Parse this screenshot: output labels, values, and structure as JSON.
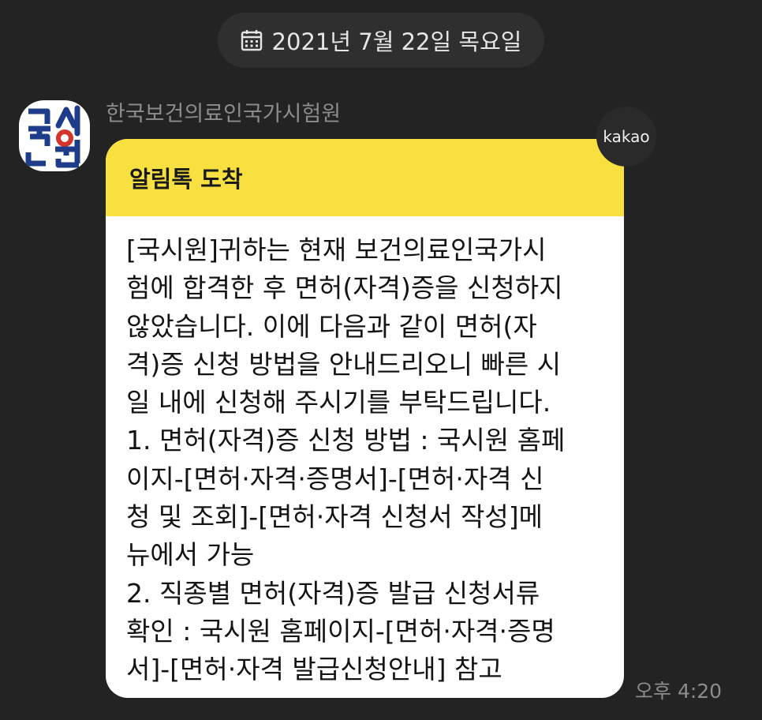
{
  "date_divider": {
    "icon": "calendar-icon",
    "text": "2021년 7월 22일 목요일"
  },
  "sender": {
    "avatar_icon": "kuksiwon-logo",
    "name": "한국보건의료인국가시험원"
  },
  "message": {
    "header_title": "알림톡 도착",
    "badge": "kakao",
    "body_lines": [
      "[국시원]귀하는 현재 보건의료인국가시",
      "험에 합격한 후 면허(자격)증을 신청하지",
      " 않았습니다. 이에 다음과 같이 면허(자",
      "격)증 신청 방법을 안내드리오니 빠른 시",
      "일 내에 신청해 주시기를 부탁드립니다.",
      "1. 면허(자격)증 신청 방법 : 국시원 홈페",
      "이지-[면허·자격·증명서]-[면허·자격 신",
      "청 및 조회]-[면허·자격 신청서 작성]메",
      "뉴에서 가능",
      "2. 직종별 면허(자격)증 발급 신청서류",
      "확인 : 국시원 홈페이지-[면허·자격·증명",
      "서]-[면허·자격 발급신청안내] 참고"
    ],
    "time": "오후 4:20"
  },
  "colors": {
    "background": "#232323",
    "header_yellow": "#f7e03f",
    "logo_blue": "#1f3c8a",
    "logo_red": "#d6332d"
  }
}
